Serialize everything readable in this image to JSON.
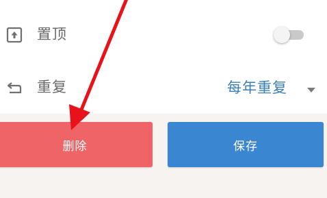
{
  "settings": {
    "pin": {
      "label": "置顶",
      "icon": "pin-to-top-icon",
      "enabled": false
    },
    "repeat": {
      "label": "重复",
      "icon": "repeat-icon",
      "value": "每年重复"
    }
  },
  "actions": {
    "delete_label": "删除",
    "save_label": "保存"
  },
  "colors": {
    "delete": "#ef6466",
    "save": "#3b86d1",
    "accent_text": "#3a7fb8",
    "annotation": "#e8121a"
  }
}
